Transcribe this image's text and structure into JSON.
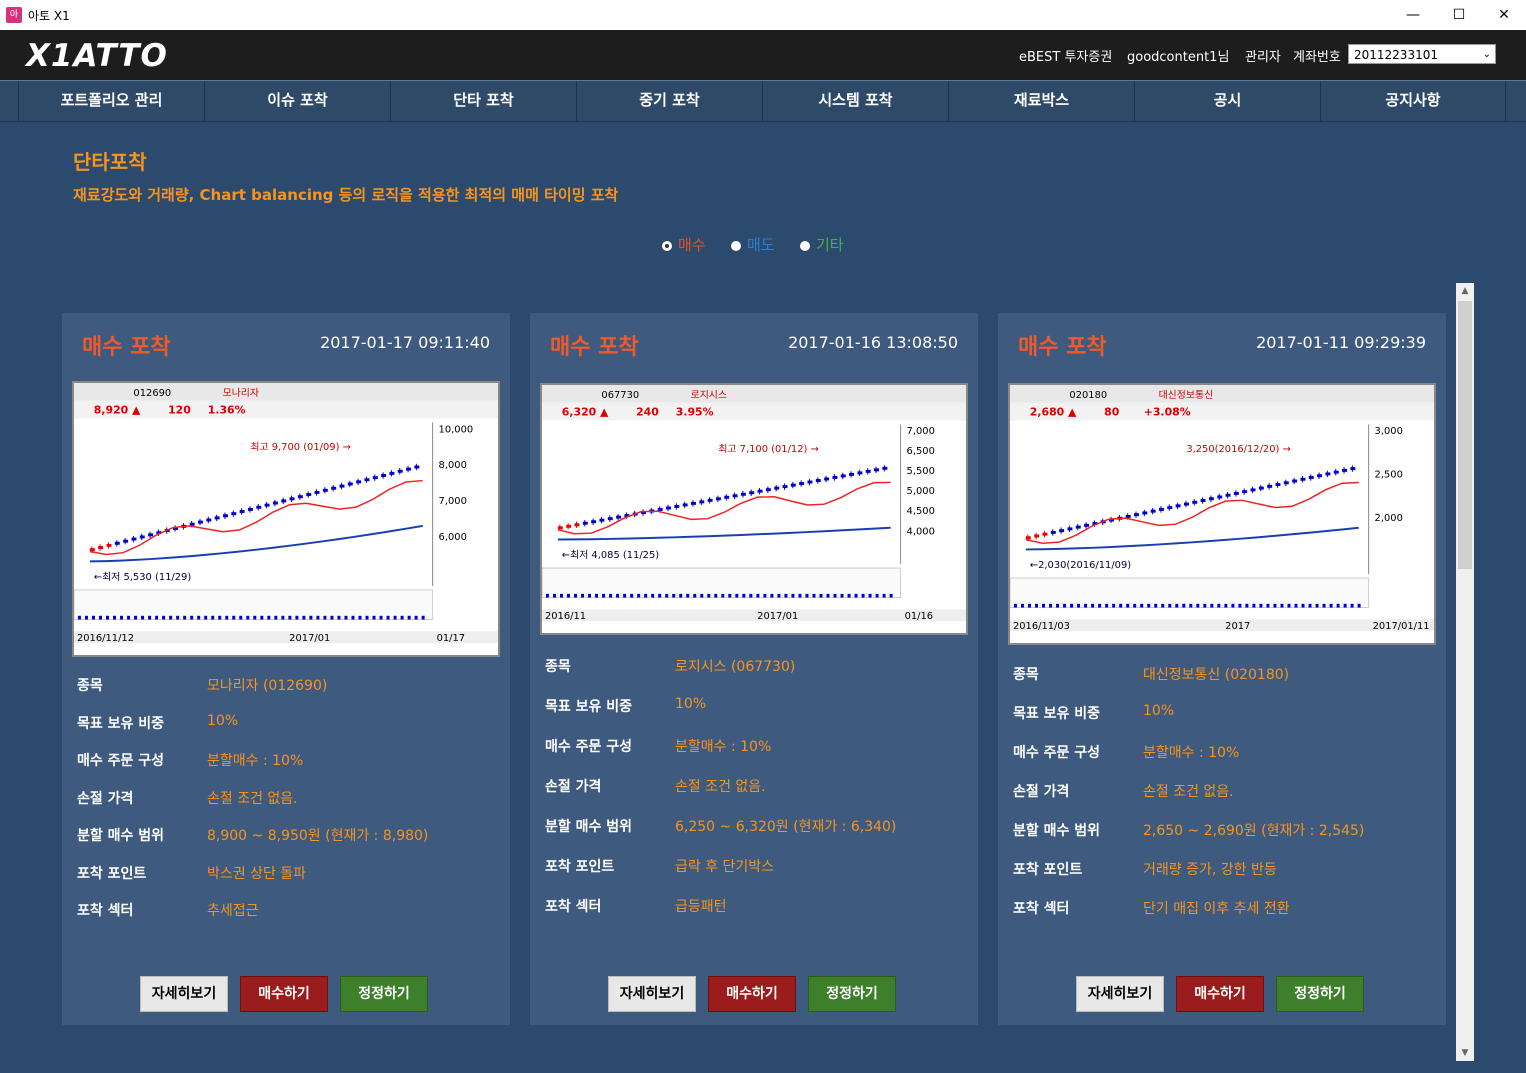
{
  "window": {
    "title": "아토 X1",
    "minimize": "—",
    "maximize": "☐",
    "close": "✕"
  },
  "header": {
    "logo": "X1ATTO",
    "broker": "eBEST 투자증권",
    "user": "goodcontent1님",
    "admin": "관리자",
    "account_label": "계좌번호",
    "account_value": "20112233101"
  },
  "nav": [
    "포트폴리오 관리",
    "이슈 포착",
    "단타 포착",
    "중기 포착",
    "시스템 포착",
    "재료박스",
    "공시",
    "공지사항"
  ],
  "section": {
    "title": "단타포착",
    "description": "재료강도와 거래량, Chart balancing 등의 로직을 적용한 최적의 매매 타이밍 포착"
  },
  "filters": [
    {
      "label": "매수",
      "color": "#ef4a23",
      "selected": true
    },
    {
      "label": "매도",
      "color": "#2a7fd4",
      "selected": false
    },
    {
      "label": "기타",
      "color": "#3fb53f",
      "selected": false
    }
  ],
  "field_labels": [
    "종목",
    "목표 보유 비중",
    "매수 주문 구성",
    "손절 가격",
    "분할 매수 범위",
    "포착 포인트",
    "포착 섹터"
  ],
  "buttons": {
    "detail": "자세히보기",
    "buy": "매수하기",
    "edit": "정정하기"
  },
  "cards": [
    {
      "title": "매수 포착",
      "datetime": "2017-01-17 09:11:40",
      "values": [
        "모나리자 (012690)",
        "10%",
        "분할매수 : 10%",
        "손절 조건 없음.",
        "8,900 ~ 8,950원 (현재가 : 8,980)",
        "박스권 상단 돌파",
        "추세접근"
      ],
      "chart": {
        "code": "012690",
        "name": "모나리자",
        "price": "8,920",
        "change": "120",
        "rate": "1.36%",
        "high": "최고 9,700 (01/09)",
        "low": "최저 5,530 (11/29)",
        "start": "2016/11/12",
        "mid": "2017/01",
        "end": "01/17",
        "ticks": [
          "10,000",
          "8,000",
          "7,000",
          "6,000"
        ]
      }
    },
    {
      "title": "매수 포착",
      "datetime": "2017-01-16 13:08:50",
      "values": [
        "로지시스 (067730)",
        "10%",
        "분할매수 : 10%",
        "손절 조건 없음.",
        "6,250 ~ 6,320원 (현재가 : 6,340)",
        "급락 후 단기박스",
        "급등패턴"
      ],
      "chart": {
        "code": "067730",
        "name": "로지시스",
        "price": "6,320",
        "change": "240",
        "rate": "3.95%",
        "high": "최고 7,100 (01/12)",
        "low": "최저 4,085 (11/25)",
        "start": "2016/11",
        "mid": "2017/01",
        "end": "01/16",
        "ticks": [
          "7,000",
          "6,500",
          "5,500",
          "5,000",
          "4,500",
          "4,000"
        ]
      }
    },
    {
      "title": "매수 포착",
      "datetime": "2017-01-11 09:29:39",
      "values": [
        "대신정보통신 (020180)",
        "10%",
        "분할매수 : 10%",
        "손절 조건 없음.",
        "2,650 ~ 2,690원 (현재가 : 2,545)",
        "거래량 증가, 강한 반등",
        "단기 매집 이후 추세 전환"
      ],
      "chart": {
        "code": "020180",
        "name": "대신정보통신",
        "price": "2,680",
        "change": "80",
        "rate": "+3.08%",
        "high": "3,250(2016/12/20)",
        "low": "2,030(2016/11/09)",
        "start": "2016/11/03",
        "mid": "2017",
        "end": "2017/01/11",
        "ticks": [
          "3,000",
          "2,500",
          "2,000"
        ]
      }
    }
  ]
}
